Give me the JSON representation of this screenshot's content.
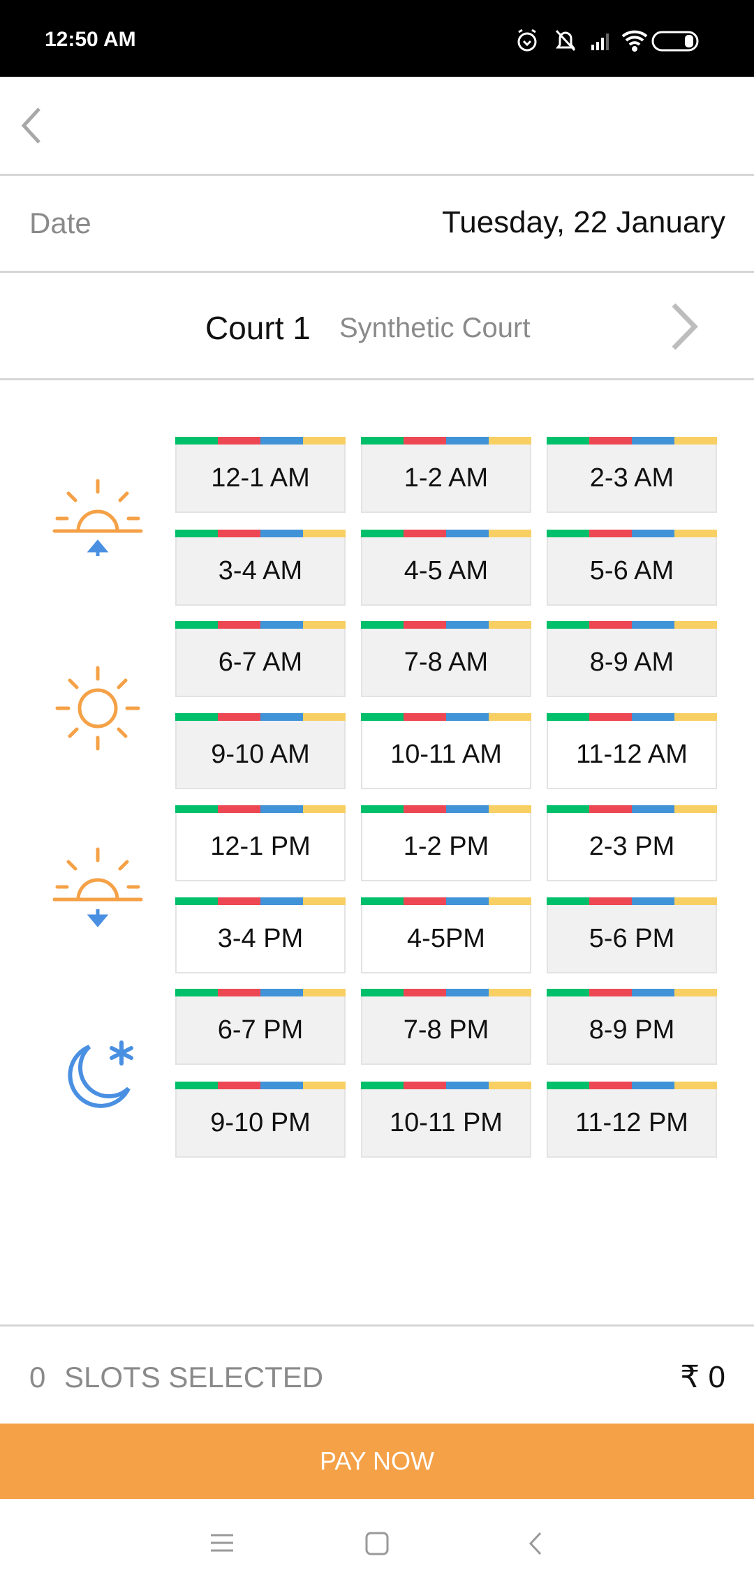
{
  "status_bar": {
    "time": "12:50 AM",
    "icons": [
      "alarm-icon",
      "silent-icon",
      "signal-icon",
      "wifi-icon",
      "battery-icon"
    ]
  },
  "date_row": {
    "label": "Date",
    "value": "Tuesday, 22 January"
  },
  "court": {
    "name": "Court 1",
    "type": "Synthetic Court"
  },
  "colors": {
    "green": "#00bf6a",
    "red": "#ec4753",
    "blue": "#4193d8",
    "yellow": "#f8cf63",
    "orange": "#f5a147",
    "slot_booked": "#f1f1f1",
    "slot_available": "#ffffff"
  },
  "periods": [
    {
      "icon": "sunrise-icon",
      "slots": [
        {
          "label": "12-1 AM",
          "available": false
        },
        {
          "label": "1-2 AM",
          "available": false
        },
        {
          "label": "2-3 AM",
          "available": false
        },
        {
          "label": "3-4 AM",
          "available": false
        },
        {
          "label": "4-5 AM",
          "available": false
        },
        {
          "label": "5-6 AM",
          "available": false
        }
      ]
    },
    {
      "icon": "sun-icon",
      "slots": [
        {
          "label": "6-7 AM",
          "available": false
        },
        {
          "label": "7-8 AM",
          "available": false
        },
        {
          "label": "8-9 AM",
          "available": false
        },
        {
          "label": "9-10 AM",
          "available": false
        },
        {
          "label": "10-11 AM",
          "available": true
        },
        {
          "label": "11-12 AM",
          "available": true
        }
      ]
    },
    {
      "icon": "sunset-icon",
      "slots": [
        {
          "label": "12-1 PM",
          "available": true
        },
        {
          "label": "1-2 PM",
          "available": true
        },
        {
          "label": "2-3 PM",
          "available": true
        },
        {
          "label": "3-4 PM",
          "available": true
        },
        {
          "label": "4-5PM",
          "available": true
        },
        {
          "label": "5-6 PM",
          "available": false
        }
      ]
    },
    {
      "icon": "moon-icon",
      "slots": [
        {
          "label": "6-7 PM",
          "available": false
        },
        {
          "label": "7-8 PM",
          "available": false
        },
        {
          "label": "8-9 PM",
          "available": false
        },
        {
          "label": "9-10 PM",
          "available": false
        },
        {
          "label": "10-11 PM",
          "available": false
        },
        {
          "label": "11-12 PM",
          "available": false
        }
      ]
    }
  ],
  "footer": {
    "count": "0",
    "slots_label": "SLOTS SELECTED",
    "price": "₹ 0",
    "pay_label": "PAY NOW"
  }
}
